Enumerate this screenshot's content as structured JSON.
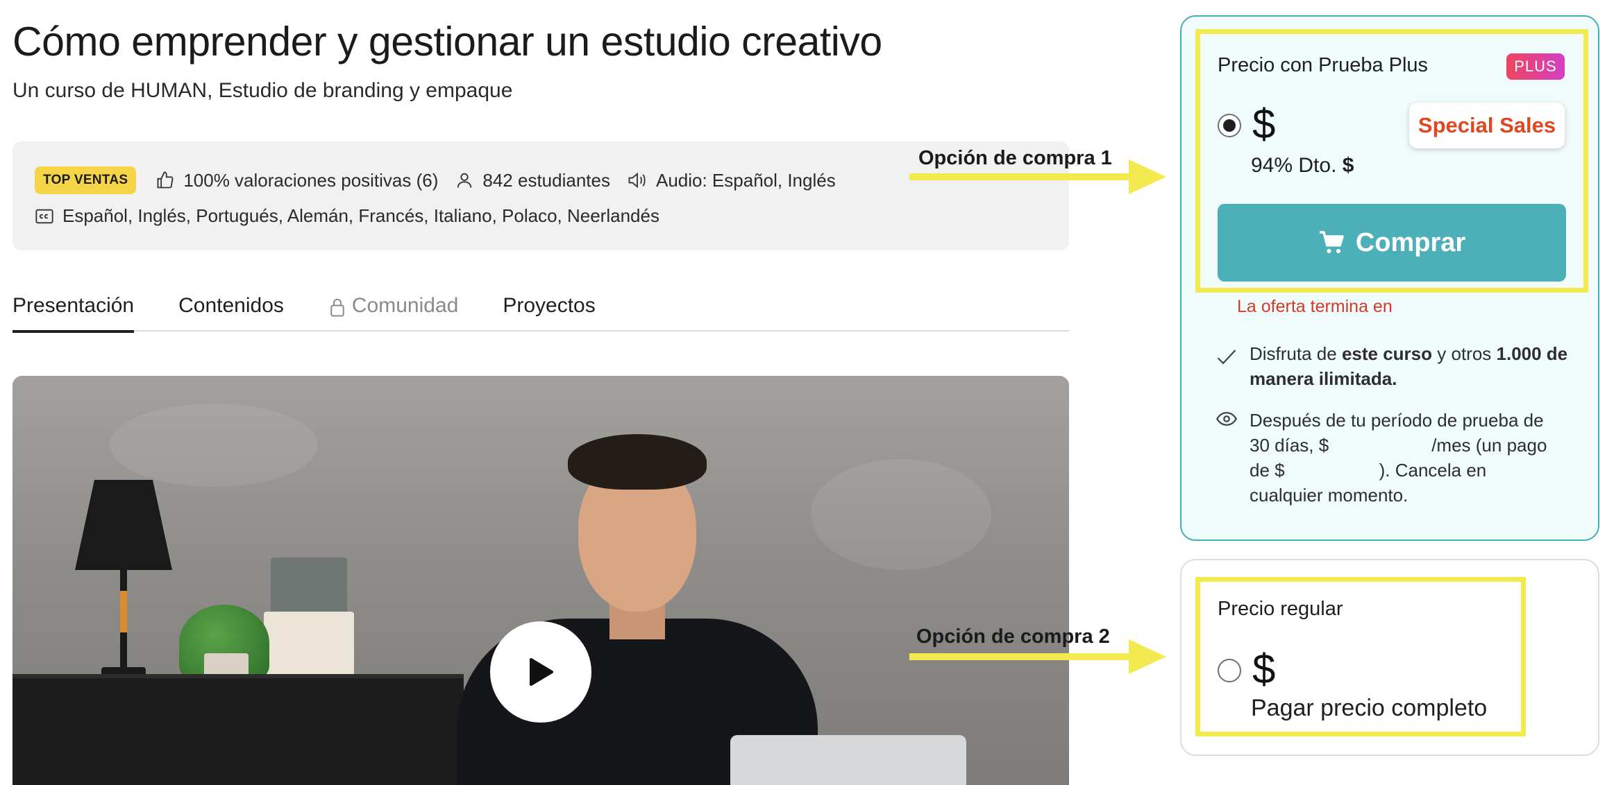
{
  "header": {
    "title": "Cómo emprender y gestionar un estudio creativo",
    "subtitle_prefix": "Un curso de ",
    "subtitle_author": "HUMAN",
    "subtitle_suffix": ", Estudio de branding y empaque"
  },
  "stats": {
    "badge": "TOP VENTAS",
    "rating": "100% valoraciones positivas (6)",
    "students": "842 estudiantes",
    "audio": "Audio: Español, Inglés",
    "subtitles": "Español, Inglés, Portugués, Alemán, Francés, Italiano, Polaco, Neerlandés",
    "icons": [
      "thumbs-up-icon",
      "user-icon",
      "speaker-icon",
      "closed-captions-icon"
    ]
  },
  "tabs": [
    {
      "label": "Presentación",
      "active": true
    },
    {
      "label": "Contenidos",
      "active": false
    },
    {
      "label": "Comunidad",
      "locked": true
    },
    {
      "label": "Proyectos",
      "active": false
    }
  ],
  "annotations": {
    "option1": "Opción de compra 1",
    "option2": "Opción de compra 2",
    "arrow_color": "#f2ea4f"
  },
  "plus_plan": {
    "label": "Precio con Prueba Plus",
    "badge": "PLUS",
    "price": "$",
    "special_sales": "Special Sales",
    "discount_text": "94% Dto. ",
    "discount_price": "$",
    "buy_label": "Comprar",
    "offer_ends": "La oferta termina en",
    "benefit1": {
      "a": "Disfruta de ",
      "b": "este curso",
      "c": " y otros ",
      "d": "1.000 de manera ilimitada."
    },
    "benefit2": {
      "line1": "Después de tu período de prueba de",
      "line2a": "30 días, $",
      "line2b": "/mes (un pago",
      "line3a": "de $",
      "line3b": "). Cancela en",
      "line4": "cualquier momento."
    },
    "selected": true
  },
  "regular_plan": {
    "label": "Precio regular",
    "price": "$",
    "note": "Pagar precio completo",
    "selected": false
  },
  "colors": {
    "accent_teal": "#4db0b9",
    "badge_yellow": "#f5d547",
    "highlight_yellow": "#f2ea4f",
    "offer_red": "#d6382a",
    "special_red": "#e0461f"
  }
}
